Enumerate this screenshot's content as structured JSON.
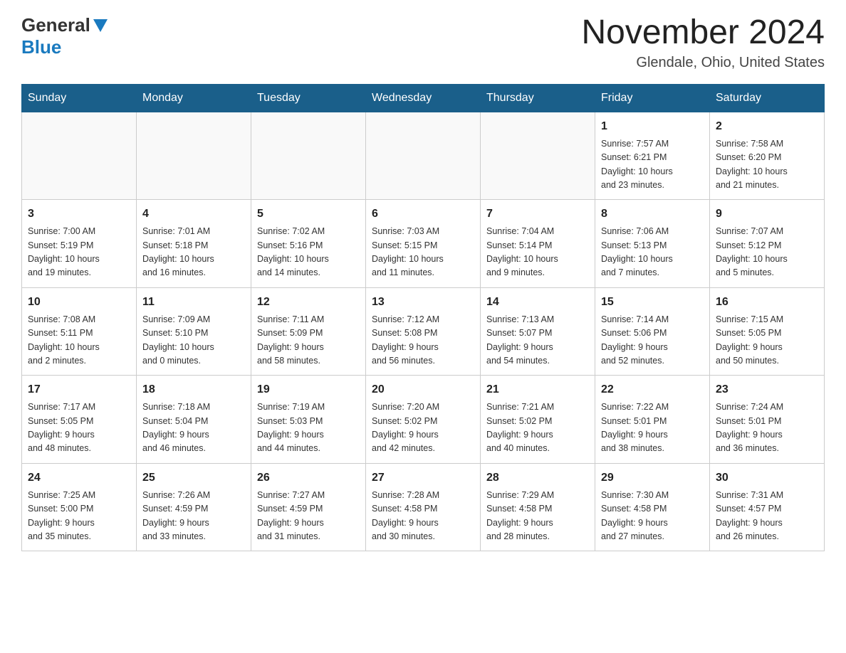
{
  "logo": {
    "general": "General",
    "blue": "Blue"
  },
  "header": {
    "month": "November 2024",
    "location": "Glendale, Ohio, United States"
  },
  "days_of_week": [
    "Sunday",
    "Monday",
    "Tuesday",
    "Wednesday",
    "Thursday",
    "Friday",
    "Saturday"
  ],
  "weeks": [
    [
      {
        "day": "",
        "info": ""
      },
      {
        "day": "",
        "info": ""
      },
      {
        "day": "",
        "info": ""
      },
      {
        "day": "",
        "info": ""
      },
      {
        "day": "",
        "info": ""
      },
      {
        "day": "1",
        "info": "Sunrise: 7:57 AM\nSunset: 6:21 PM\nDaylight: 10 hours\nand 23 minutes."
      },
      {
        "day": "2",
        "info": "Sunrise: 7:58 AM\nSunset: 6:20 PM\nDaylight: 10 hours\nand 21 minutes."
      }
    ],
    [
      {
        "day": "3",
        "info": "Sunrise: 7:00 AM\nSunset: 5:19 PM\nDaylight: 10 hours\nand 19 minutes."
      },
      {
        "day": "4",
        "info": "Sunrise: 7:01 AM\nSunset: 5:18 PM\nDaylight: 10 hours\nand 16 minutes."
      },
      {
        "day": "5",
        "info": "Sunrise: 7:02 AM\nSunset: 5:16 PM\nDaylight: 10 hours\nand 14 minutes."
      },
      {
        "day": "6",
        "info": "Sunrise: 7:03 AM\nSunset: 5:15 PM\nDaylight: 10 hours\nand 11 minutes."
      },
      {
        "day": "7",
        "info": "Sunrise: 7:04 AM\nSunset: 5:14 PM\nDaylight: 10 hours\nand 9 minutes."
      },
      {
        "day": "8",
        "info": "Sunrise: 7:06 AM\nSunset: 5:13 PM\nDaylight: 10 hours\nand 7 minutes."
      },
      {
        "day": "9",
        "info": "Sunrise: 7:07 AM\nSunset: 5:12 PM\nDaylight: 10 hours\nand 5 minutes."
      }
    ],
    [
      {
        "day": "10",
        "info": "Sunrise: 7:08 AM\nSunset: 5:11 PM\nDaylight: 10 hours\nand 2 minutes."
      },
      {
        "day": "11",
        "info": "Sunrise: 7:09 AM\nSunset: 5:10 PM\nDaylight: 10 hours\nand 0 minutes."
      },
      {
        "day": "12",
        "info": "Sunrise: 7:11 AM\nSunset: 5:09 PM\nDaylight: 9 hours\nand 58 minutes."
      },
      {
        "day": "13",
        "info": "Sunrise: 7:12 AM\nSunset: 5:08 PM\nDaylight: 9 hours\nand 56 minutes."
      },
      {
        "day": "14",
        "info": "Sunrise: 7:13 AM\nSunset: 5:07 PM\nDaylight: 9 hours\nand 54 minutes."
      },
      {
        "day": "15",
        "info": "Sunrise: 7:14 AM\nSunset: 5:06 PM\nDaylight: 9 hours\nand 52 minutes."
      },
      {
        "day": "16",
        "info": "Sunrise: 7:15 AM\nSunset: 5:05 PM\nDaylight: 9 hours\nand 50 minutes."
      }
    ],
    [
      {
        "day": "17",
        "info": "Sunrise: 7:17 AM\nSunset: 5:05 PM\nDaylight: 9 hours\nand 48 minutes."
      },
      {
        "day": "18",
        "info": "Sunrise: 7:18 AM\nSunset: 5:04 PM\nDaylight: 9 hours\nand 46 minutes."
      },
      {
        "day": "19",
        "info": "Sunrise: 7:19 AM\nSunset: 5:03 PM\nDaylight: 9 hours\nand 44 minutes."
      },
      {
        "day": "20",
        "info": "Sunrise: 7:20 AM\nSunset: 5:02 PM\nDaylight: 9 hours\nand 42 minutes."
      },
      {
        "day": "21",
        "info": "Sunrise: 7:21 AM\nSunset: 5:02 PM\nDaylight: 9 hours\nand 40 minutes."
      },
      {
        "day": "22",
        "info": "Sunrise: 7:22 AM\nSunset: 5:01 PM\nDaylight: 9 hours\nand 38 minutes."
      },
      {
        "day": "23",
        "info": "Sunrise: 7:24 AM\nSunset: 5:01 PM\nDaylight: 9 hours\nand 36 minutes."
      }
    ],
    [
      {
        "day": "24",
        "info": "Sunrise: 7:25 AM\nSunset: 5:00 PM\nDaylight: 9 hours\nand 35 minutes."
      },
      {
        "day": "25",
        "info": "Sunrise: 7:26 AM\nSunset: 4:59 PM\nDaylight: 9 hours\nand 33 minutes."
      },
      {
        "day": "26",
        "info": "Sunrise: 7:27 AM\nSunset: 4:59 PM\nDaylight: 9 hours\nand 31 minutes."
      },
      {
        "day": "27",
        "info": "Sunrise: 7:28 AM\nSunset: 4:58 PM\nDaylight: 9 hours\nand 30 minutes."
      },
      {
        "day": "28",
        "info": "Sunrise: 7:29 AM\nSunset: 4:58 PM\nDaylight: 9 hours\nand 28 minutes."
      },
      {
        "day": "29",
        "info": "Sunrise: 7:30 AM\nSunset: 4:58 PM\nDaylight: 9 hours\nand 27 minutes."
      },
      {
        "day": "30",
        "info": "Sunrise: 7:31 AM\nSunset: 4:57 PM\nDaylight: 9 hours\nand 26 minutes."
      }
    ]
  ]
}
